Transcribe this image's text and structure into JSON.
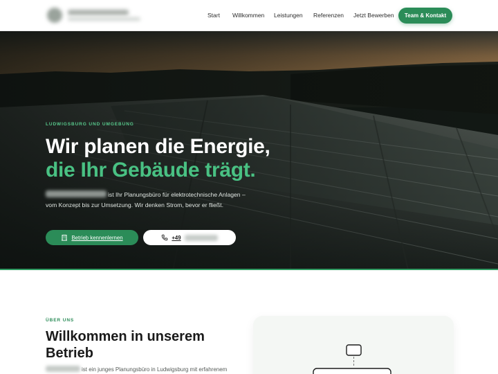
{
  "nav": {
    "items": [
      {
        "label": "Start"
      },
      {
        "label": "Willkommen"
      },
      {
        "label": "Leistungen"
      },
      {
        "label": "Referenzen"
      },
      {
        "label": "Jetzt Bewerben"
      }
    ],
    "cta_label": "Team & Kontakt"
  },
  "hero": {
    "eyebrow": "LUDWIGSBURG UND UMGEBUNG",
    "title_line1": "Wir planen die Energie,",
    "title_line2": "die Ihr Gebäude trägt.",
    "text": "ist Ihr Planungsbüro für elektrotechnische Anlagen – vom Konzept bis zur Umsetzung. Wir denken Strom, bevor er fließt.",
    "primary_button": "Betrieb kennenlernen",
    "primary_icon": "building-icon",
    "phone_prefix": "+49",
    "phone_icon": "phone-icon"
  },
  "about": {
    "eyebrow": "ÜBER UNS",
    "title": "Willkommen in unserem Betrieb",
    "text": "ist ein junges Planungsbüro in Ludwigsburg mit erfahrenem"
  },
  "colors": {
    "accent": "#2b8c58",
    "accent_light": "#49c183",
    "eyebrow_green": "#58c98c"
  }
}
